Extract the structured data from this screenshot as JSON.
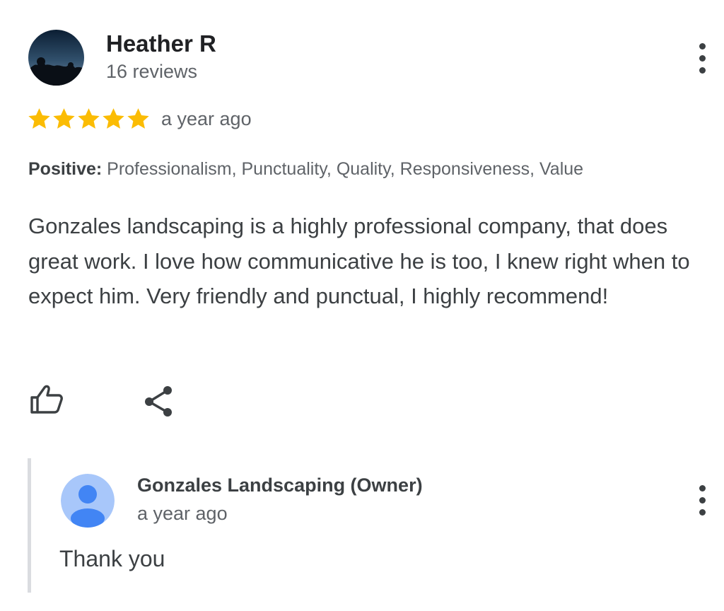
{
  "review": {
    "reviewer_name": "Heather R",
    "reviewer_reviews": "16 reviews",
    "rating": 5,
    "max_rating": 5,
    "time": "a year ago",
    "attributes_label": "Positive:",
    "attributes_value": " Professionalism, Punctuality, Quality, Responsiveness, Value",
    "text": "Gonzales landscaping is a highly professional company, that does great work. I love how communicative he is too, I knew right when to expect him. Very friendly and punctual, I highly recommend!"
  },
  "actions": {
    "like_icon": "thumbs-up-icon",
    "share_icon": "share-icon"
  },
  "reply": {
    "owner_name": "Gonzales Landscaping (Owner)",
    "time": "a year ago",
    "text": "Thank you"
  },
  "colors": {
    "star": "#FBBC04",
    "owner_avatar_bg": "#A8C7FA",
    "owner_avatar_fg": "#4285F4",
    "reply_border": "#DADCE0"
  }
}
